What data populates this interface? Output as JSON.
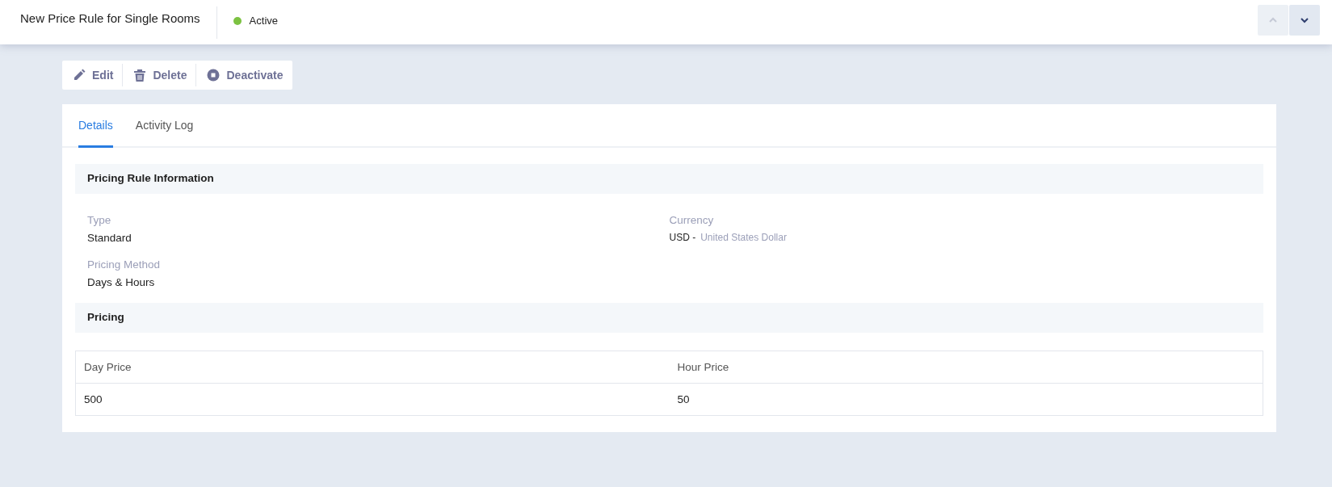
{
  "header": {
    "title": "New Price Rule for Single Rooms",
    "status": {
      "label": "Active",
      "color": "#7cc242"
    },
    "nav": [
      {
        "kind": "up",
        "disabled": true
      },
      {
        "kind": "down",
        "disabled": false
      }
    ]
  },
  "actions": [
    {
      "kind": "edit",
      "label": "Edit"
    },
    {
      "kind": "delete",
      "label": "Delete"
    },
    {
      "kind": "deactivate",
      "label": "Deactivate"
    }
  ],
  "tabs": [
    {
      "label": "Details",
      "selected": true
    },
    {
      "label": "Activity Log",
      "selected": false
    }
  ],
  "sections": [
    {
      "title": "Pricing Rule Information",
      "fields": [
        {
          "label": "Type",
          "value": "Standard"
        },
        {
          "label": "Currency",
          "code": "USD -",
          "value": "United States Dollar"
        },
        {
          "label": "Pricing Method",
          "value": "Days & Hours"
        }
      ]
    },
    {
      "title": "Pricing",
      "table": {
        "columns": [
          "Day Price",
          "Hour Price"
        ],
        "rows": [
          [
            "500",
            "50"
          ]
        ]
      }
    }
  ]
}
